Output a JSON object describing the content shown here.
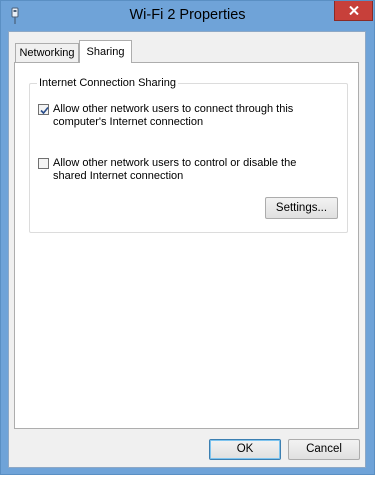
{
  "window": {
    "title": "Wi-Fi 2 Properties",
    "accent_color": "#6fa3d8",
    "close_color": "#c7403a"
  },
  "icons": {
    "app": "network-adapter-icon",
    "close": "close-icon",
    "check": "checkmark-icon"
  },
  "tabs": [
    {
      "label": "Networking",
      "active": false
    },
    {
      "label": "Sharing",
      "active": true
    }
  ],
  "sharing": {
    "group_label": "Internet Connection Sharing",
    "allow_connect": {
      "checked": true,
      "label": "Allow other network users to connect through this computer's Internet connection"
    },
    "allow_control": {
      "checked": false,
      "label": "Allow other network users to control or disable the shared Internet connection"
    },
    "settings_label": "Settings..."
  },
  "footer": {
    "ok_label": "OK",
    "cancel_label": "Cancel"
  }
}
